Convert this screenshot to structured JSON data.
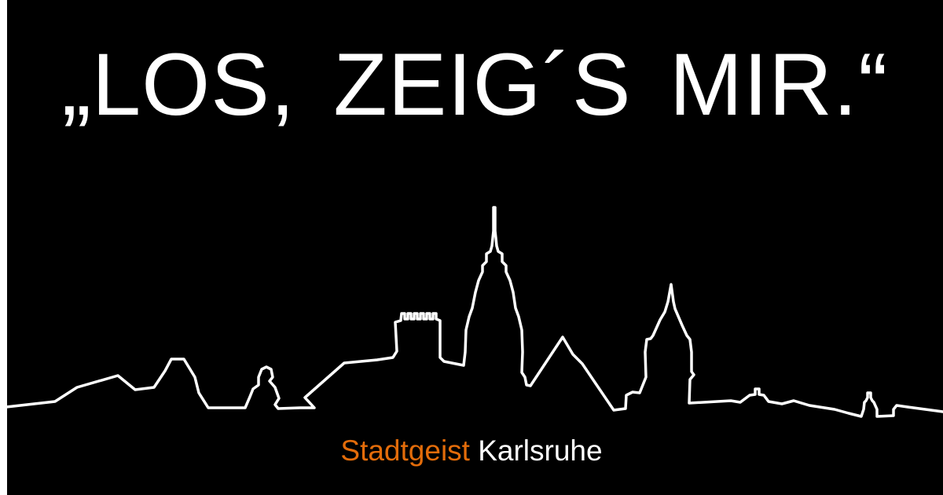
{
  "headline": "„LOS, ZEIG´S MIR.“",
  "brand": {
    "accent_word": "Stadtgeist",
    "city_word": "Karlsruhe"
  },
  "colors": {
    "background": "#000000",
    "text": "#ffffff",
    "accent": "#e36c0a",
    "skyline_stroke": "#ffffff"
  },
  "illustration": {
    "icon": "city-skyline-outline-icon"
  }
}
